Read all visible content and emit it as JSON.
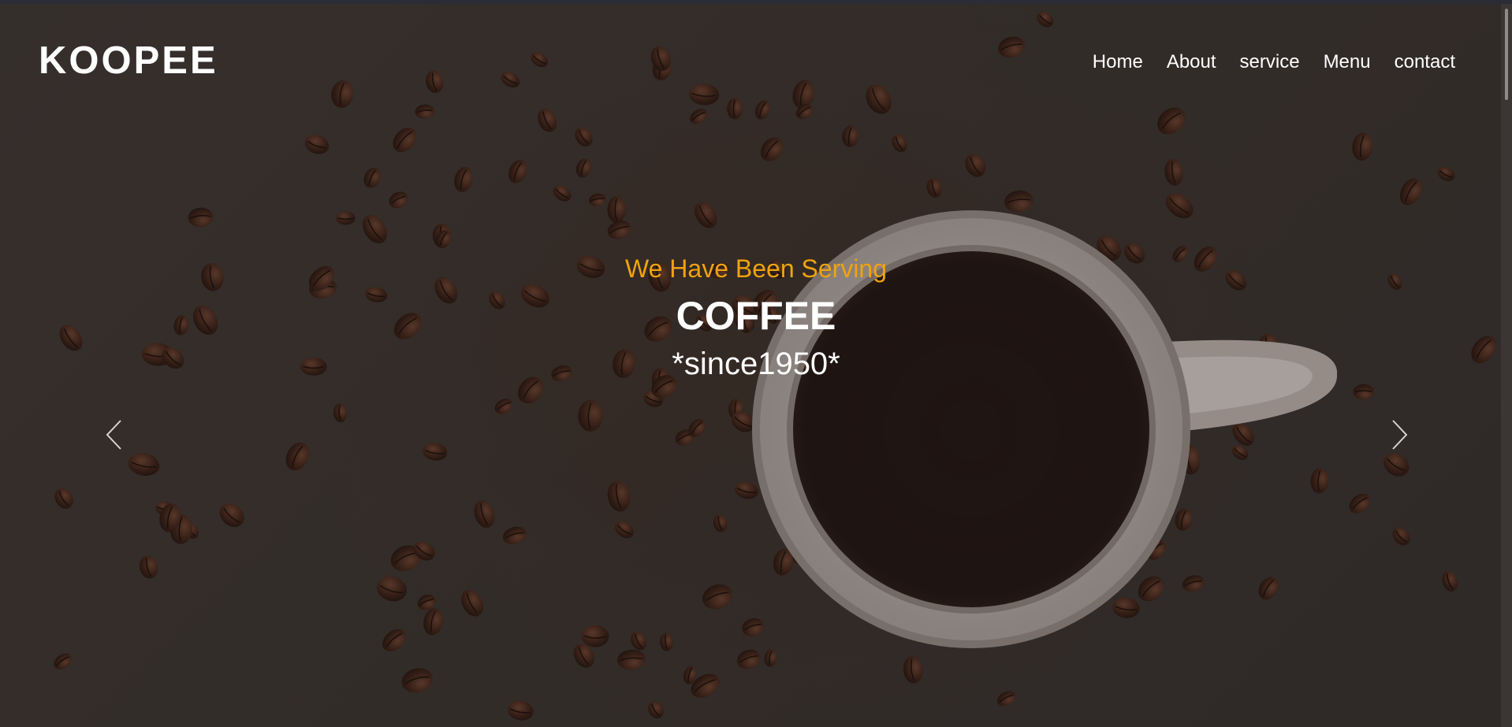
{
  "brand": {
    "name": "KOOPEE"
  },
  "nav": {
    "items": [
      {
        "label": "Home"
      },
      {
        "label": "About"
      },
      {
        "label": "service"
      },
      {
        "label": "Menu"
      },
      {
        "label": "contact"
      }
    ]
  },
  "hero": {
    "tagline": "We Have Been Serving",
    "headline": "COFFEE",
    "since": "*since1950*",
    "background_image": "coffee-cup-and-beans-photo",
    "controls": {
      "prev_icon": "chevron-left-icon",
      "next_icon": "chevron-right-icon"
    }
  },
  "colors": {
    "accent": "#f0a30e",
    "text": "#ffffff",
    "overlay": "#3a3431"
  }
}
